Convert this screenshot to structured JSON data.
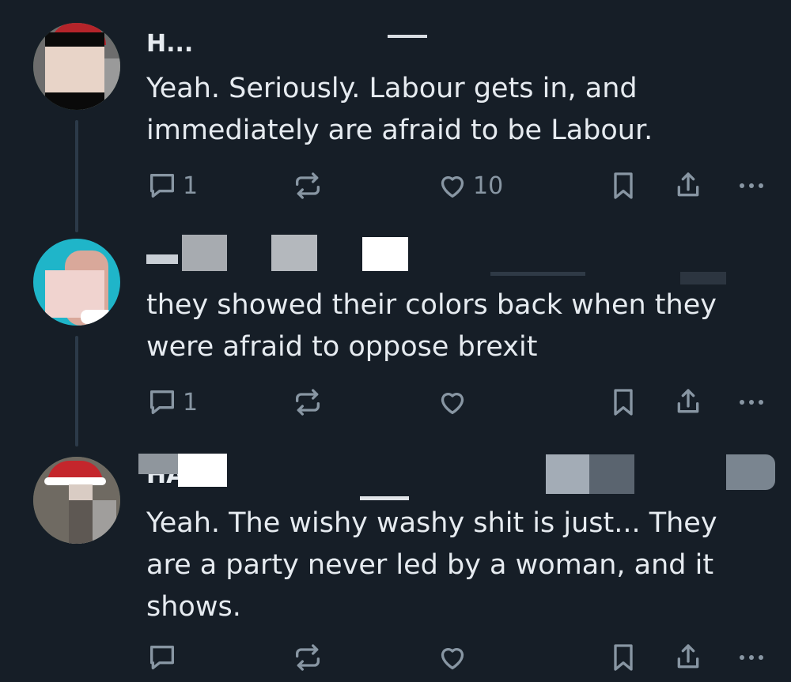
{
  "posts": [
    {
      "author": "H...",
      "timestamp": "",
      "text": "Yeah. Seriously. Labour gets in, and\nimmediately are afraid to be Labour.",
      "reply_count": "1",
      "like_count": "10"
    },
    {
      "author": "",
      "timestamp": "",
      "text": "they showed their colors back when they\nwere afraid to oppose brexit",
      "reply_count": "1",
      "like_count": ""
    },
    {
      "author": "HA",
      "timestamp": "",
      "text": "Yeah. The wishy washy shit is just... They\nare a party never led by a woman, and it\nshows.",
      "reply_count": "",
      "like_count": ""
    }
  ],
  "icons": {
    "reply": "reply-icon",
    "repost": "repost-icon",
    "like": "heart-icon",
    "bookmark": "bookmark-icon",
    "share": "share-icon",
    "more": "more-icon"
  },
  "colors": {
    "background": "#161e27",
    "text": "#e6ebf0",
    "muted": "#8896a3",
    "thread_line": "#2c3a49"
  }
}
